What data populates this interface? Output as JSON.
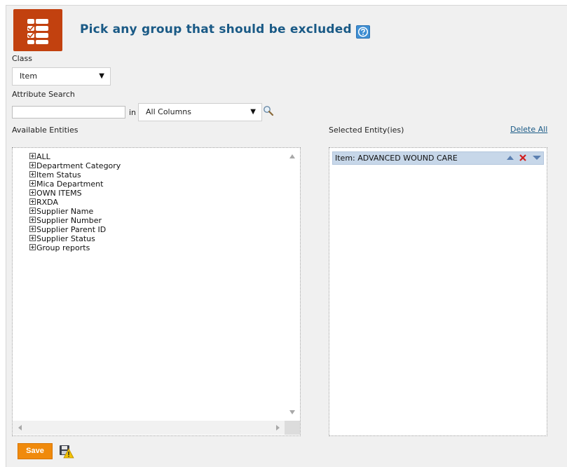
{
  "header": {
    "title": "Pick any group that should be excluded",
    "help_icon": "question-circle-icon",
    "logo_icon": "checklist-icon"
  },
  "class_field": {
    "label": "Class",
    "value": "Item"
  },
  "attribute_search": {
    "label": "Attribute Search",
    "value": "",
    "in_label": "in",
    "column_value": "All Columns",
    "search_icon": "magnifier-icon"
  },
  "available": {
    "label": "Available Entities",
    "items": [
      {
        "label": "ALL"
      },
      {
        "label": "Department Category"
      },
      {
        "label": "Item Status"
      },
      {
        "label": "Mica Department"
      },
      {
        "label": "OWN ITEMS"
      },
      {
        "label": "RXDA"
      },
      {
        "label": "Supplier Name"
      },
      {
        "label": "Supplier Number"
      },
      {
        "label": "Supplier Parent ID"
      },
      {
        "label": "Supplier Status"
      },
      {
        "label": "Group reports"
      }
    ]
  },
  "selected": {
    "label": "Selected Entity(ies)",
    "delete_all": "Delete All",
    "items": [
      {
        "label": "Item: ADVANCED WOUND CARE"
      }
    ]
  },
  "footer": {
    "save_label": "Save",
    "save_warning_icon": "disk-warning-icon"
  },
  "colors": {
    "logo_bg": "#c2410f",
    "title": "#1a5a86",
    "save_button": "#f08a0c",
    "selected_item_bg": "#c7d7e9"
  }
}
